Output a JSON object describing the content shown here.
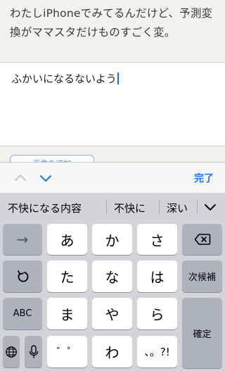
{
  "comment": {
    "line1": "わたしiPhoneでみてるんだけど、予測変",
    "line2": "換がママスタだけものすごく変。"
  },
  "input": {
    "value": "ふかいになるないよう"
  },
  "add_image_button": {
    "label": "画像を追加"
  },
  "accessory_bar": {
    "prev_icon": "chevron-up-icon",
    "next_icon": "chevron-down-icon",
    "done_label": "完了",
    "accent_color": "#1a73e8"
  },
  "predictions": [
    "不快になる内容",
    "不快に",
    "深い"
  ],
  "keyboard": {
    "row1": {
      "arrow": "→",
      "k1": "あ",
      "k2": "か",
      "k3": "さ",
      "backspace_icon": "backspace-icon"
    },
    "row2": {
      "undo_icon": "undo-icon",
      "k1": "た",
      "k2": "な",
      "k3": "は",
      "next_candidate": "次候補"
    },
    "row3": {
      "abc": "ABC",
      "k1": "ま",
      "k2": "や",
      "k3": "ら",
      "confirm": "確定"
    },
    "row4": {
      "globe_icon": "globe-icon",
      "mic_icon": "microphone-icon",
      "k1": "゛゜",
      "k2": "わ",
      "k3": "、。?!"
    }
  }
}
